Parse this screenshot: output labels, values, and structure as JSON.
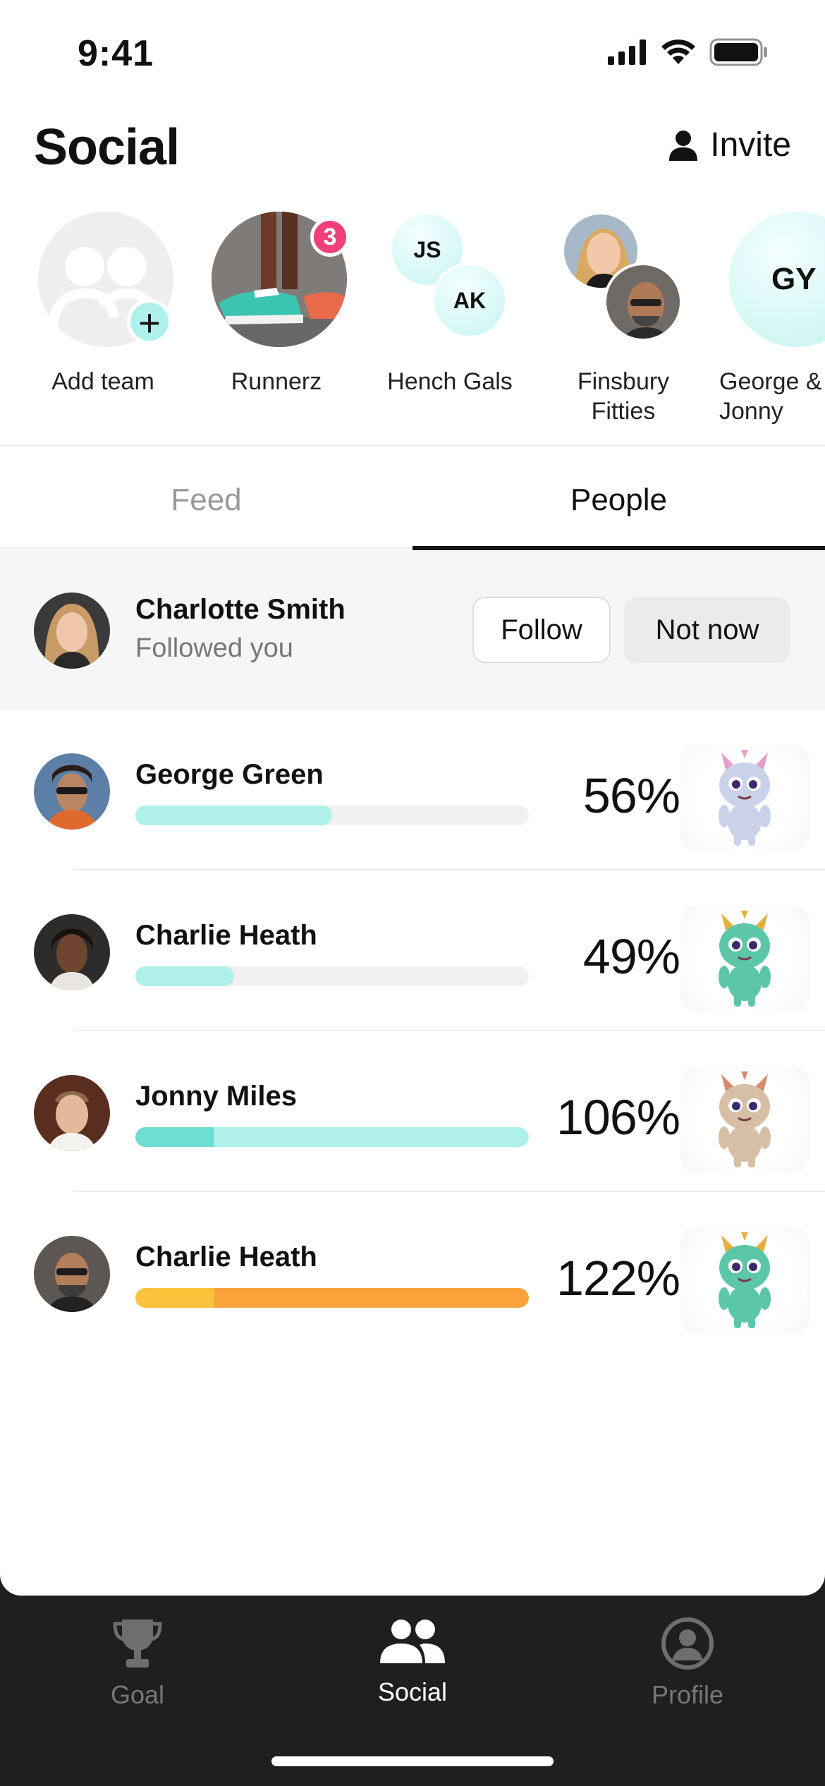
{
  "status_bar": {
    "time": "9:41"
  },
  "header": {
    "title": "Social",
    "invite_label": "Invite"
  },
  "teams": [
    {
      "label": "Add team"
    },
    {
      "label": "Runnerz",
      "badge": "3"
    },
    {
      "label": "Hench Gals",
      "initials": [
        "JS",
        "AK"
      ]
    },
    {
      "label": "Finsbury Fitties"
    },
    {
      "label": "George & Jonny",
      "initials": [
        "GY"
      ]
    }
  ],
  "tabs": [
    {
      "label": "Feed",
      "active": false
    },
    {
      "label": "People",
      "active": true
    }
  ],
  "follow_request": {
    "name": "Charlotte Smith",
    "subtitle": "Followed you",
    "follow_label": "Follow",
    "not_now_label": "Not now"
  },
  "people": [
    {
      "name": "George Green",
      "percent": "56%",
      "progress": 0.5,
      "bar_color": "#aef1ea",
      "bar_color2": "#aef1ea"
    },
    {
      "name": "Charlie Heath",
      "percent": "49%",
      "progress": 0.25,
      "bar_color": "#aef1ea",
      "bar_color2": "#aef1ea"
    },
    {
      "name": "Jonny Miles",
      "percent": "106%",
      "progress": 1.0,
      "bar_color": "#aef1ea",
      "bar_color2": "#6fdcd3"
    },
    {
      "name": "Charlie Heath",
      "percent": "122%",
      "progress": 1.0,
      "bar_color": "#f9a33a",
      "bar_color2": "#fbc23b"
    }
  ],
  "nav": [
    {
      "label": "Goal",
      "icon": "trophy-icon",
      "active": false
    },
    {
      "label": "Social",
      "icon": "people-icon",
      "active": true
    },
    {
      "label": "Profile",
      "icon": "profile-icon",
      "active": false
    }
  ]
}
